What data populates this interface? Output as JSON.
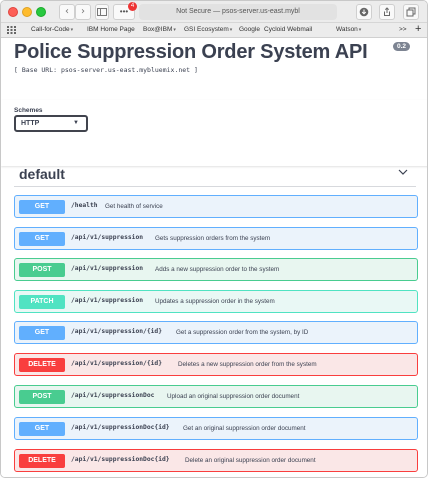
{
  "browser": {
    "address_text": "Not Secure — psos-server.us-east.mybl",
    "extension_badge": "4",
    "extension_label": "•••",
    "favorites": [
      {
        "label": "Call-for-Code"
      },
      {
        "label": "IBM Home Page"
      },
      {
        "label": "Box@IBM"
      },
      {
        "label": "GSI Ecosystem"
      },
      {
        "label": "Google"
      },
      {
        "label": "Cycloid Webmail"
      },
      {
        "label": "Watson"
      }
    ],
    "favorites_overflow": ">>"
  },
  "api": {
    "title": "Police Suppression Order System API",
    "version": "0.2",
    "base_url": "[ Base URL: psos-server.us-east.mybluemix.net ]"
  },
  "schemes": {
    "label": "Schemes",
    "selected": "HTTP"
  },
  "tag": {
    "name": "default"
  },
  "operations": [
    {
      "method": "GET",
      "path": "/health",
      "summary": "Get health of service"
    },
    {
      "method": "GET",
      "path": "/api/v1/suppression",
      "summary": "Gets suppression orders from the system"
    },
    {
      "method": "POST",
      "path": "/api/v1/suppression",
      "summary": "Adds a new suppression order to the system"
    },
    {
      "method": "PATCH",
      "path": "/api/v1/suppression",
      "summary": "Updates a suppression order in the system"
    },
    {
      "method": "GET",
      "path": "/api/v1/suppression/{id}",
      "summary": "Get a suppression order from the system, by ID"
    },
    {
      "method": "DELETE",
      "path": "/api/v1/suppression/{id}",
      "summary": "Deletes a new suppression order from the system"
    },
    {
      "method": "POST",
      "path": "/api/v1/suppressionDoc",
      "summary": "Upload an original suppression order document"
    },
    {
      "method": "GET",
      "path": "/api/v1/suppressionDoc{id}",
      "summary": "Get an original suppression order document"
    },
    {
      "method": "DELETE",
      "path": "/api/v1/suppressionDoc{id}",
      "summary": "Delete an original suppression order document"
    }
  ],
  "colors": {
    "get": "#61affe",
    "post": "#49cc90",
    "patch": "#50e3c2",
    "delete": "#f93e3e"
  }
}
